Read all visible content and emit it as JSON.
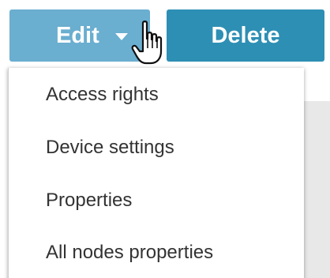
{
  "toolbar": {
    "edit_label": "Edit",
    "delete_label": "Delete"
  },
  "menu": {
    "items": [
      {
        "label": "Access rights"
      },
      {
        "label": "Device settings"
      },
      {
        "label": "Properties"
      },
      {
        "label": "All nodes properties"
      }
    ]
  },
  "colors": {
    "edit_button": "#6aaed0",
    "delete_button": "#2e8fb4",
    "menu_text": "#333333"
  },
  "icons": {
    "pointer": "hand-pointer-icon",
    "caret": "caret-down-icon"
  }
}
